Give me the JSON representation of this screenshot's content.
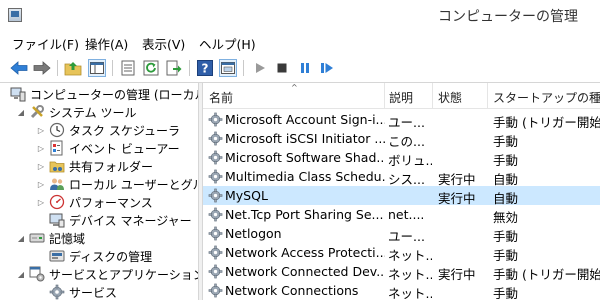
{
  "window": {
    "title": "コンピューターの管理"
  },
  "menu": [
    "ファイル(F)",
    "操作(A)",
    "表示(V)",
    "ヘルプ(H)"
  ],
  "toolbar": {
    "icons": [
      "back-arrow-icon",
      "forward-arrow-icon",
      "folder-up-icon",
      "show-hide-tree-icon",
      "properties-icon",
      "refresh-icon",
      "export-list-icon",
      "help-icon",
      "view-icon",
      "play-icon",
      "stop-icon",
      "pause-icon",
      "restart-icon"
    ]
  },
  "tree": {
    "root": "コンピューターの管理 (ローカル)",
    "system_tools": "システム ツール",
    "task_scheduler": "タスク スケジューラ",
    "event_viewer": "イベント ビューアー",
    "shared_folders": "共有フォルダー",
    "local_users": "ローカル ユーザーとグループ",
    "performance": "パフォーマンス",
    "device_manager": "デバイス マネージャー",
    "storage": "記憶域",
    "disk_management": "ディスクの管理",
    "services_apps": "サービスとアプリケーション",
    "services": "サービス"
  },
  "list": {
    "headers": {
      "name": "名前",
      "description": "説明",
      "status": "状態",
      "startup": "スタートアップの種類"
    },
    "rows": [
      {
        "name": "Microsoft Account Sign-i...",
        "description": "ユー...",
        "status": "",
        "startup": "手動 (トリガー開始)"
      },
      {
        "name": "Microsoft iSCSI Initiator ...",
        "description": "この...",
        "status": "",
        "startup": "手動"
      },
      {
        "name": "Microsoft Software Shad...",
        "description": "ボリュ...",
        "status": "",
        "startup": "手動"
      },
      {
        "name": "Multimedia Class Schedu...",
        "description": "シス...",
        "status": "実行中",
        "startup": "自動"
      },
      {
        "name": "MySQL",
        "description": "",
        "status": "実行中",
        "startup": "自動"
      },
      {
        "name": "Net.Tcp Port Sharing Se...",
        "description": "net....",
        "status": "",
        "startup": "無効"
      },
      {
        "name": "Netlogon",
        "description": "ユー...",
        "status": "",
        "startup": "手動"
      },
      {
        "name": "Network Access Protecti...",
        "description": "ネット...",
        "status": "",
        "startup": "手動"
      },
      {
        "name": "Network Connected Dev...",
        "description": "ネット...",
        "status": "実行中",
        "startup": "手動 (トリガー開始)"
      },
      {
        "name": "Network Connections",
        "description": "ネット...",
        "status": "",
        "startup": "手動"
      }
    ],
    "selected_index": 4
  },
  "colors": {
    "selection": "#cce8ff",
    "accent": "#3a6ea5"
  }
}
